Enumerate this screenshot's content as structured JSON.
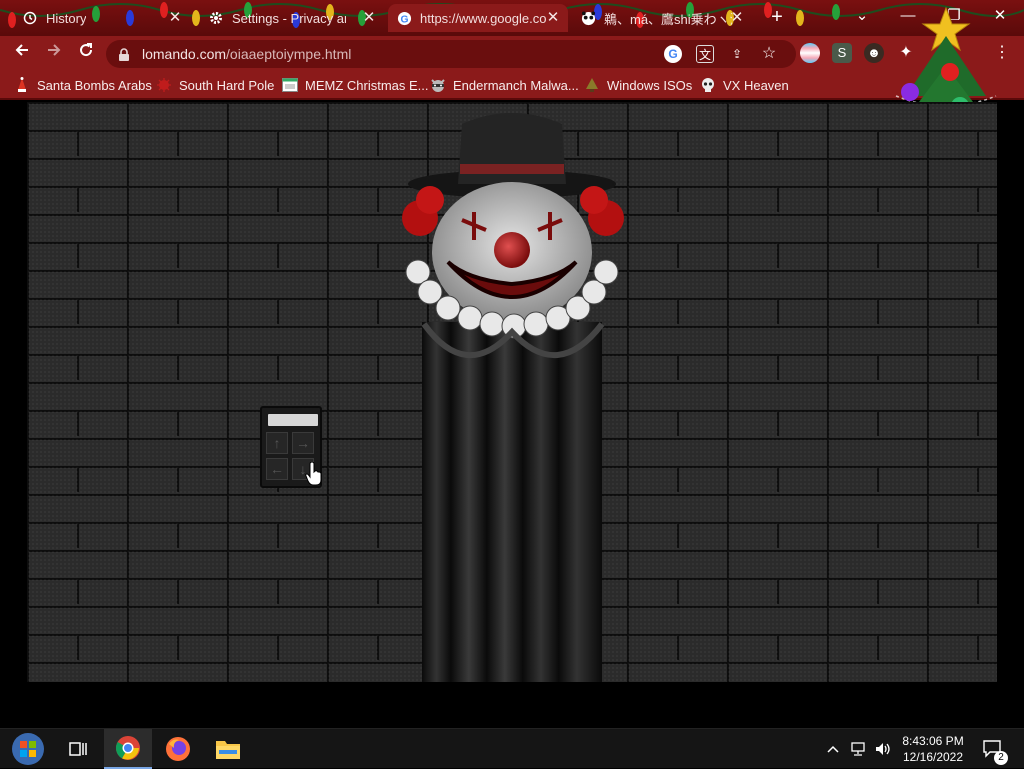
{
  "browser": {
    "tabs": [
      {
        "label": "History",
        "icon": "history-icon",
        "active": false
      },
      {
        "label": "Settings - Privacy and s",
        "icon": "gear-icon",
        "active": false
      },
      {
        "label": "https://www.google.co",
        "icon": "google-icon",
        "active": true
      },
      {
        "label": "鵜、má、鷹shi乗わヽ汰",
        "icon": "panda-icon",
        "active": false
      }
    ],
    "new_tab": "+",
    "window_controls": {
      "tab_search": "⌄",
      "minimize": "—",
      "restore": "❐",
      "close": "✕"
    },
    "address": {
      "domain": "lomando.com",
      "path": "/oiaaeptoiympe.html"
    }
  },
  "bookmarks": [
    {
      "label": "Santa Bombs Arabs",
      "icon": "santa-icon"
    },
    {
      "label": "South Hard Pole",
      "icon": "bug-icon"
    },
    {
      "label": "MEMZ Christmas E...",
      "icon": "window-icon"
    },
    {
      "label": "Endermanch Malwa...",
      "icon": "raccoon-icon"
    },
    {
      "label": "Windows ISOs",
      "icon": "tree-icon"
    },
    {
      "label": "VX Heaven",
      "icon": "skull-icon"
    }
  ],
  "page": {
    "device_keys": [
      "↑",
      "→",
      "←",
      "↓"
    ]
  },
  "taskbar": {
    "time": "8:43:06 PM",
    "date": "12/16/2022",
    "notification_count": "2"
  },
  "colors": {
    "chrome_frame": "#8b1a1a",
    "tab_strip": "#6a0e0e",
    "brick": "#2b2b2b",
    "taskbar": "#151515"
  }
}
